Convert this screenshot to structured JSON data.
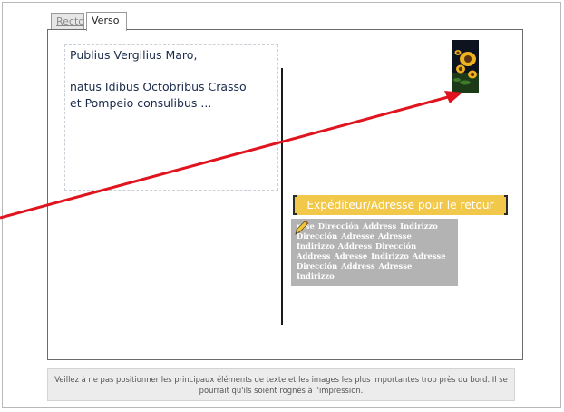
{
  "tabs": [
    {
      "label": "Recto",
      "active": false
    },
    {
      "label": "Verso",
      "active": true
    }
  ],
  "card": {
    "text_lines": [
      "Publius Vergilius Maro,",
      "natus Idibus Octobribus Crasso\net Pompeio consulibus ..."
    ],
    "stamp_icon": "sunflower-photo",
    "sender_label": "Expéditeur/Adresse pour le retour",
    "address_placeholder": "rese Dirección Address Indirizzo Dirección Adresse Adresse Indirizzo Address Dirección Address Adresse Indirizzo Adresse Dirección Address Adresse Indirizzo",
    "edit_icon": "pencil-icon"
  },
  "notice": "Veillez à ne pas positionner les principaux éléments de texte et les images les plus importantes trop près du bord. Il se pourrait qu'ils soient rognés à l'impression.",
  "colors": {
    "sender_label_bg": "#f2c84a",
    "address_bg": "#b3b3b3",
    "annotation_arrow": "#e0141e"
  }
}
